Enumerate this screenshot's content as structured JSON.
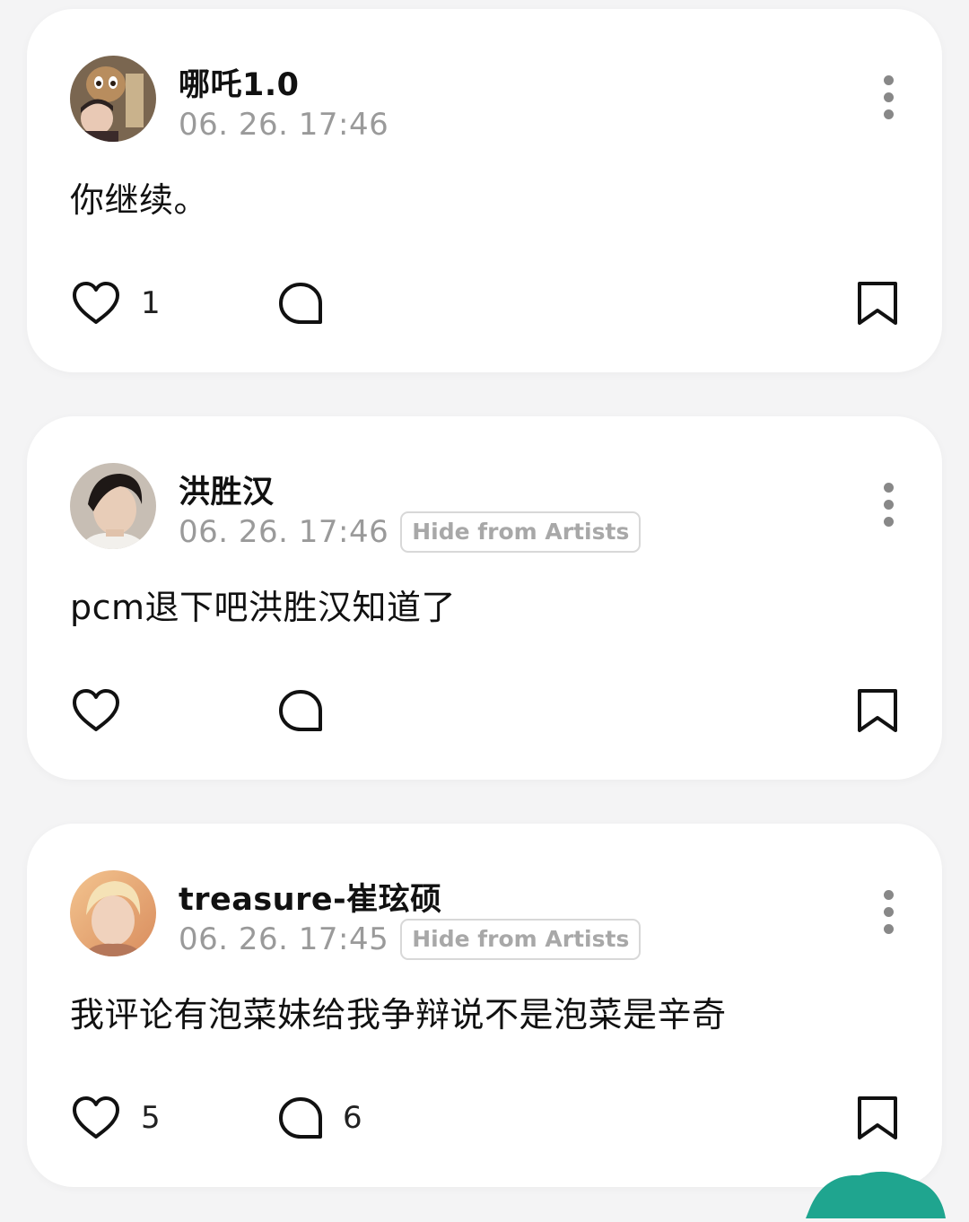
{
  "posts": [
    {
      "username": "哪吒1.0",
      "time": "06. 26. 17:46",
      "badge": "",
      "content": "你继续。",
      "likes": "1",
      "comments": ""
    },
    {
      "username": "洪胜汉",
      "time": "06. 26. 17:46",
      "badge": "Hide from Artists",
      "content": "pcm退下吧洪胜汉知道了",
      "likes": "",
      "comments": ""
    },
    {
      "username": "treasure-崔玹硕",
      "time": "06. 26. 17:45",
      "badge": "Hide from Artists",
      "content": "我评论有泡菜妹给我争辩说不是泡菜是辛奇",
      "likes": "5",
      "comments": "6"
    }
  ],
  "icons": {
    "like": "heart-outline-icon",
    "comment": "speech-bubble-icon",
    "save": "bookmark-outline-icon",
    "more": "vertical-ellipsis-icon"
  },
  "colors": {
    "background": "#f4f4f5",
    "card": "#ffffff",
    "text": "#111111",
    "muted": "#9a9a9a",
    "badge_border": "#d8d8d8",
    "accent_blob": "#1fa58f"
  }
}
